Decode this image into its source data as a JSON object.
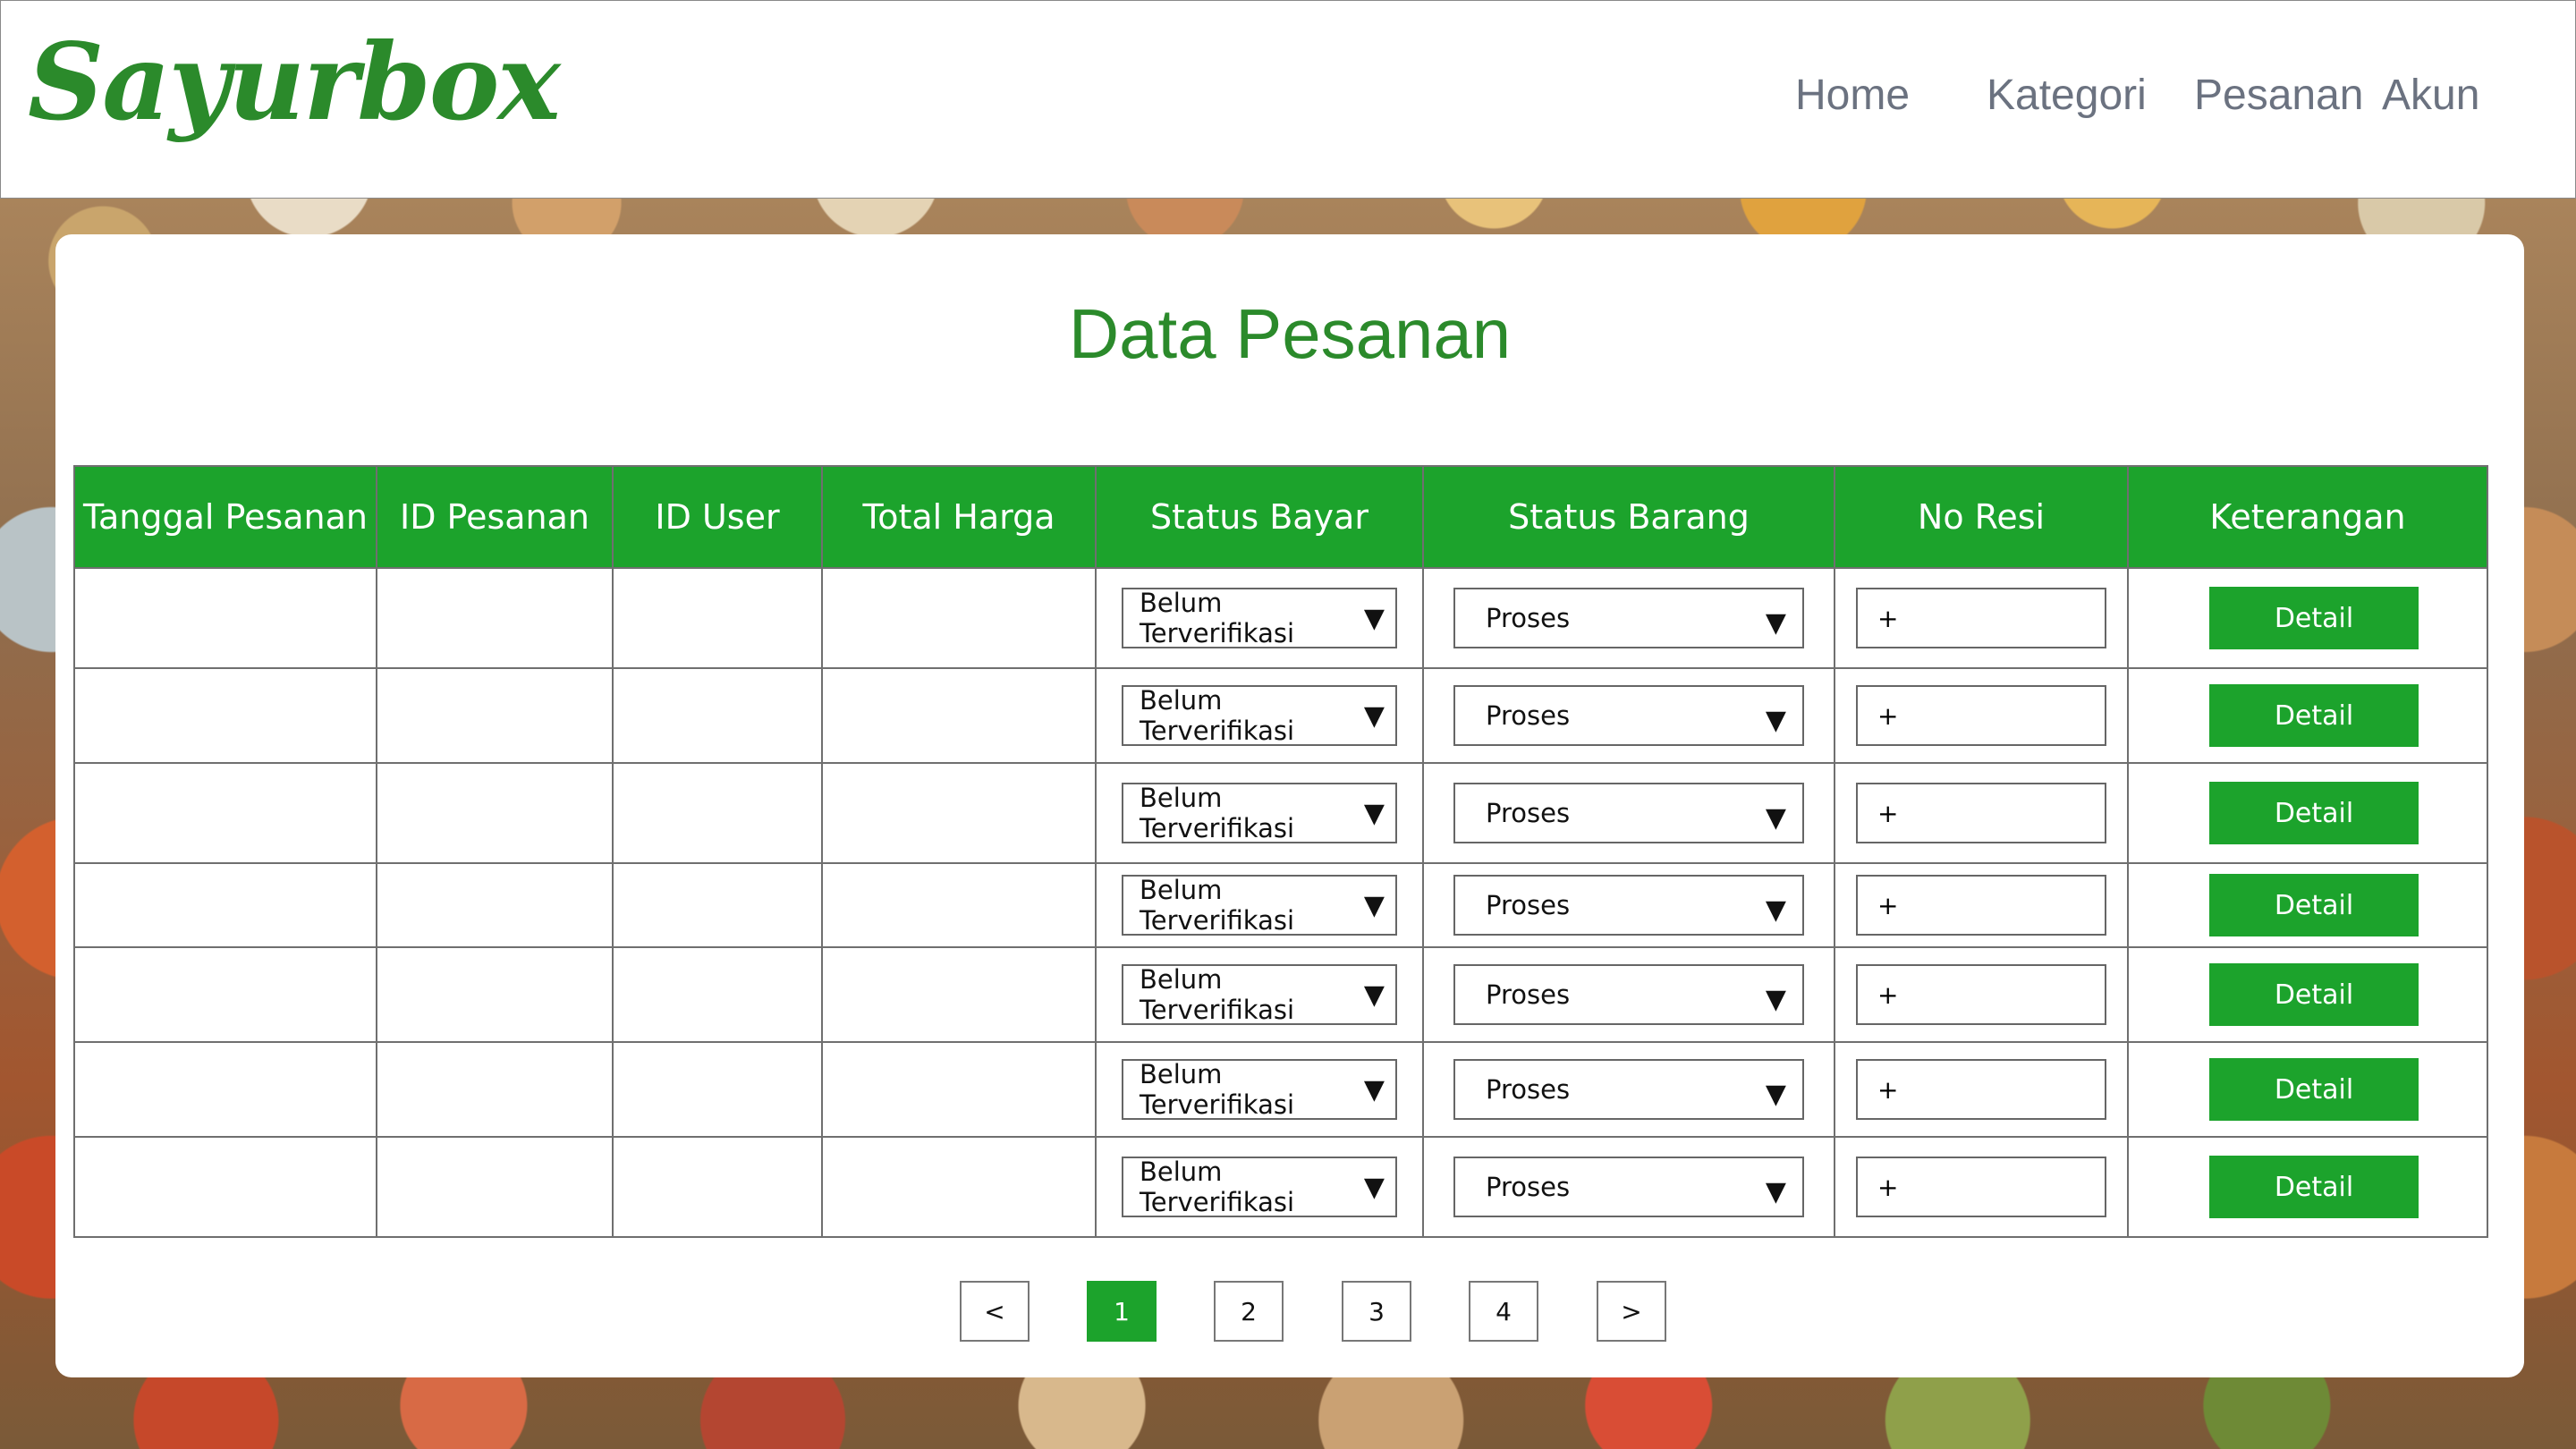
{
  "navbar": {
    "brand": "Sayurbox",
    "links": [
      "Home",
      "Kategori",
      "Pesanan",
      "Akun"
    ]
  },
  "page_title": "Data Pesanan",
  "table": {
    "headers": [
      "Tanggal Pesanan",
      "ID Pesanan",
      "ID User",
      "Total Harga",
      "Status Bayar",
      "Status Barang",
      "No Resi",
      "Keterangan"
    ],
    "rows": [
      {
        "tanggal": "",
        "id_pesanan": "",
        "id_user": "",
        "total_harga": "",
        "status_bayar": "Belum Terverifikasi",
        "status_barang": "Proses",
        "no_resi": "+",
        "keterangan": "Detail"
      },
      {
        "tanggal": "",
        "id_pesanan": "",
        "id_user": "",
        "total_harga": "",
        "status_bayar": "Belum Terverifikasi",
        "status_barang": "Proses",
        "no_resi": "+",
        "keterangan": "Detail"
      },
      {
        "tanggal": "",
        "id_pesanan": "",
        "id_user": "",
        "total_harga": "",
        "status_bayar": "Belum Terverifikasi",
        "status_barang": "Proses",
        "no_resi": "+",
        "keterangan": "Detail"
      },
      {
        "tanggal": "",
        "id_pesanan": "",
        "id_user": "",
        "total_harga": "",
        "status_bayar": "Belum Terverifikasi",
        "status_barang": "Proses",
        "no_resi": "+",
        "keterangan": "Detail"
      },
      {
        "tanggal": "",
        "id_pesanan": "",
        "id_user": "",
        "total_harga": "",
        "status_bayar": "Belum Terverifikasi",
        "status_barang": "Proses",
        "no_resi": "+",
        "keterangan": "Detail"
      },
      {
        "tanggal": "",
        "id_pesanan": "",
        "id_user": "",
        "total_harga": "",
        "status_bayar": "Belum Terverifikasi",
        "status_barang": "Proses",
        "no_resi": "+",
        "keterangan": "Detail"
      },
      {
        "tanggal": "",
        "id_pesanan": "",
        "id_user": "",
        "total_harga": "",
        "status_bayar": "Belum Terverifikasi",
        "status_barang": "Proses",
        "no_resi": "+",
        "keterangan": "Detail"
      }
    ]
  },
  "pagination": {
    "prev": "<",
    "pages": [
      "1",
      "2",
      "3",
      "4"
    ],
    "current": "1",
    "next": ">"
  },
  "colors": {
    "brand_green": "#2b8a2b",
    "header_green": "#1ca32c",
    "nav_text": "#6b7280"
  },
  "icons": {
    "dropdown_caret": "caret-down-icon"
  }
}
